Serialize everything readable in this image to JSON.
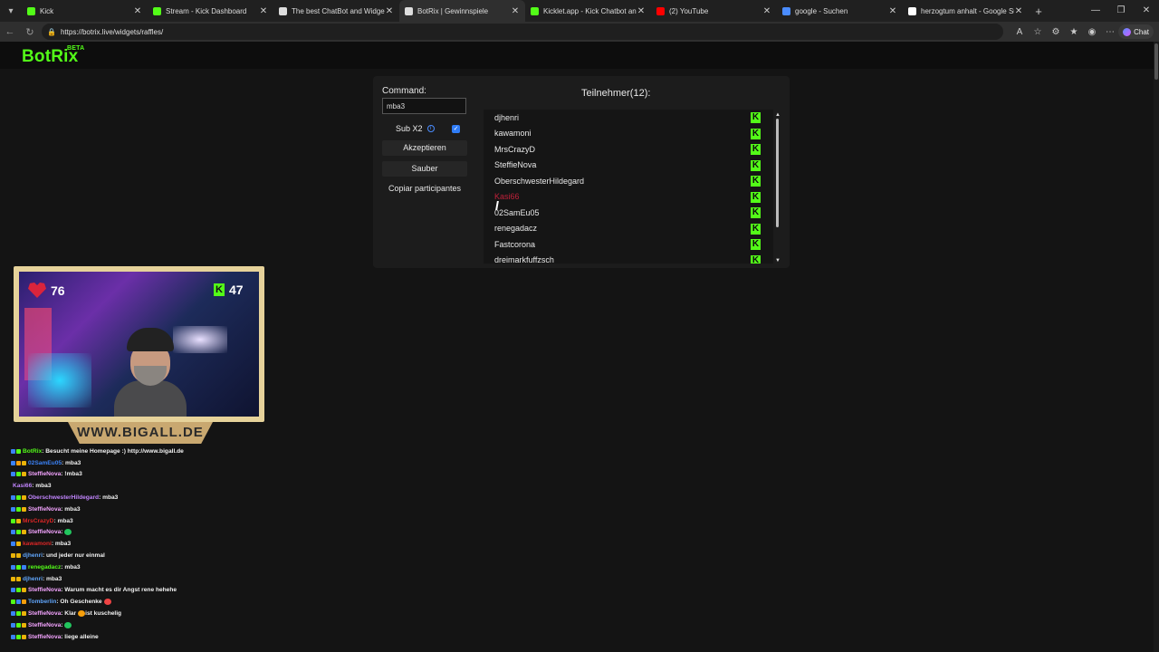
{
  "browser": {
    "tabs": [
      {
        "title": "Kick",
        "favicon": "kick-icon",
        "fav_color": "#53fc18",
        "active": false
      },
      {
        "title": "Stream - Kick Dashboard",
        "favicon": "kick-icon",
        "fav_color": "#53fc18",
        "active": false
      },
      {
        "title": "The best ChatBot and Widgets for",
        "favicon": "botrix-icon",
        "fav_color": "#dddddd",
        "active": false
      },
      {
        "title": "BotRix | Gewinnspiele",
        "favicon": "botrix-icon",
        "fav_color": "#dddddd",
        "active": true
      },
      {
        "title": "Kicklet.app - Kick Chatbot and Ov",
        "favicon": "kicklet-icon",
        "fav_color": "#53fc18",
        "active": false
      },
      {
        "title": "(2) YouTube",
        "favicon": "youtube-icon",
        "fav_color": "#ff0000",
        "active": false
      },
      {
        "title": "google - Suchen",
        "favicon": "search-icon",
        "fav_color": "#4a8cff",
        "active": false
      },
      {
        "title": "herzogtum anhalt - Google Suche",
        "favicon": "google-icon",
        "fav_color": "#ffffff",
        "active": false
      }
    ],
    "url": "https://botrix.live/widgets/raffles/",
    "chat_button": "Chat"
  },
  "site": {
    "logo": "BotRix",
    "logo_badge": "BETA",
    "accent": "#53fc18"
  },
  "raffle": {
    "command_label": "Command:",
    "command_value": "mba3",
    "sub_label": "Sub X2",
    "sub_checked": true,
    "accept_button": "Akzeptieren",
    "clear_button": "Sauber",
    "copy_button": "Copiar participantes",
    "participants_title": "Teilnehmer(12):",
    "participants": [
      {
        "name": "djhenri",
        "hover": false
      },
      {
        "name": "kawamoni",
        "hover": false
      },
      {
        "name": "MrsCrazyD",
        "hover": false
      },
      {
        "name": "SteffieNova",
        "hover": false
      },
      {
        "name": "OberschwesterHildegard",
        "hover": false
      },
      {
        "name": "Kasi66",
        "hover": true
      },
      {
        "name": "02SamEu05",
        "hover": false
      },
      {
        "name": "renegadacz",
        "hover": false
      },
      {
        "name": "Fastcorona",
        "hover": false
      },
      {
        "name": "dreimarkfuffzsch",
        "hover": false
      }
    ],
    "platform_badge": "K"
  },
  "webcam": {
    "heart_count": "76",
    "follower_count": "47",
    "banner": "WWW.BIGALL.DE"
  },
  "chat": [
    {
      "user": "BotRix",
      "color": "#53fc18",
      "text": ": Besucht meine Homepage :) http://www.bigall.de",
      "badges": [
        "#3b82f6",
        "#53fc18"
      ]
    },
    {
      "user": "02SamEu05",
      "color": "#3b82f6",
      "text": ": mba3",
      "badges": [
        "#3b82f6",
        "#f59e0b",
        "#eab308"
      ]
    },
    {
      "user": "SteffieNova",
      "color": "#f4a4ff",
      "text": ": !mba3",
      "badges": [
        "#3b82f6",
        "#53fc18",
        "#eab308"
      ]
    },
    {
      "user": "Kasi66",
      "color": "#c084fc",
      "text": ": mba3",
      "badges": []
    },
    {
      "user": "OberschwesterHildegard",
      "color": "#c084fc",
      "text": ": mba3",
      "badges": [
        "#3b82f6",
        "#53fc18",
        "#eab308"
      ]
    },
    {
      "user": "SteffieNova",
      "color": "#f4a4ff",
      "text": ": mba3",
      "badges": [
        "#3b82f6",
        "#53fc18",
        "#eab308"
      ]
    },
    {
      "user": "MrsCrazyD",
      "color": "#dc2626",
      "text": ": mba3",
      "badges": [
        "#53fc18",
        "#eab308"
      ]
    },
    {
      "user": "SteffieNova",
      "color": "#f4a4ff",
      "text": ": ",
      "badges": [
        "#3b82f6",
        "#53fc18",
        "#eab308"
      ],
      "emoji": "#22c55e"
    },
    {
      "user": "kawamoni",
      "color": "#dc2626",
      "text": ": mba3",
      "badges": [
        "#3b82f6",
        "#eab308"
      ]
    },
    {
      "user": "djhenri",
      "color": "#60a5fa",
      "text": ": und jeder nur einmal",
      "badges": [
        "#eab308",
        "#eab308"
      ]
    },
    {
      "user": "renegadacz",
      "color": "#53fc18",
      "text": ": mba3",
      "badges": [
        "#3b82f6",
        "#53fc18",
        "#3b82f6"
      ]
    },
    {
      "user": "djhenri",
      "color": "#60a5fa",
      "text": ": mba3",
      "badges": [
        "#eab308",
        "#eab308"
      ]
    },
    {
      "user": "SteffieNova",
      "color": "#f4a4ff",
      "text": ": Warum macht es dir Angst rene hehehe",
      "badges": [
        "#3b82f6",
        "#53fc18",
        "#eab308"
      ]
    },
    {
      "user": "Tomberlin",
      "color": "#60a5fa",
      "text": ": Oh Geschenke",
      "badges": [
        "#53fc18",
        "#3b82f6",
        "#f59e0b"
      ],
      "emoji": "#ef4444"
    },
    {
      "user": "SteffieNova",
      "color": "#f4a4ff",
      "text": ": Klar",
      "badges": [
        "#3b82f6",
        "#53fc18",
        "#eab308"
      ],
      "emoji": "#f59e0b",
      "after": " ist kuschelig"
    },
    {
      "user": "SteffieNova",
      "color": "#f4a4ff",
      "text": ": ",
      "badges": [
        "#3b82f6",
        "#53fc18",
        "#eab308"
      ],
      "emoji": "#22c55e"
    },
    {
      "user": "SteffieNova",
      "color": "#f4a4ff",
      "text": ": liege alleine",
      "badges": [
        "#3b82f6",
        "#53fc18",
        "#eab308"
      ]
    }
  ]
}
